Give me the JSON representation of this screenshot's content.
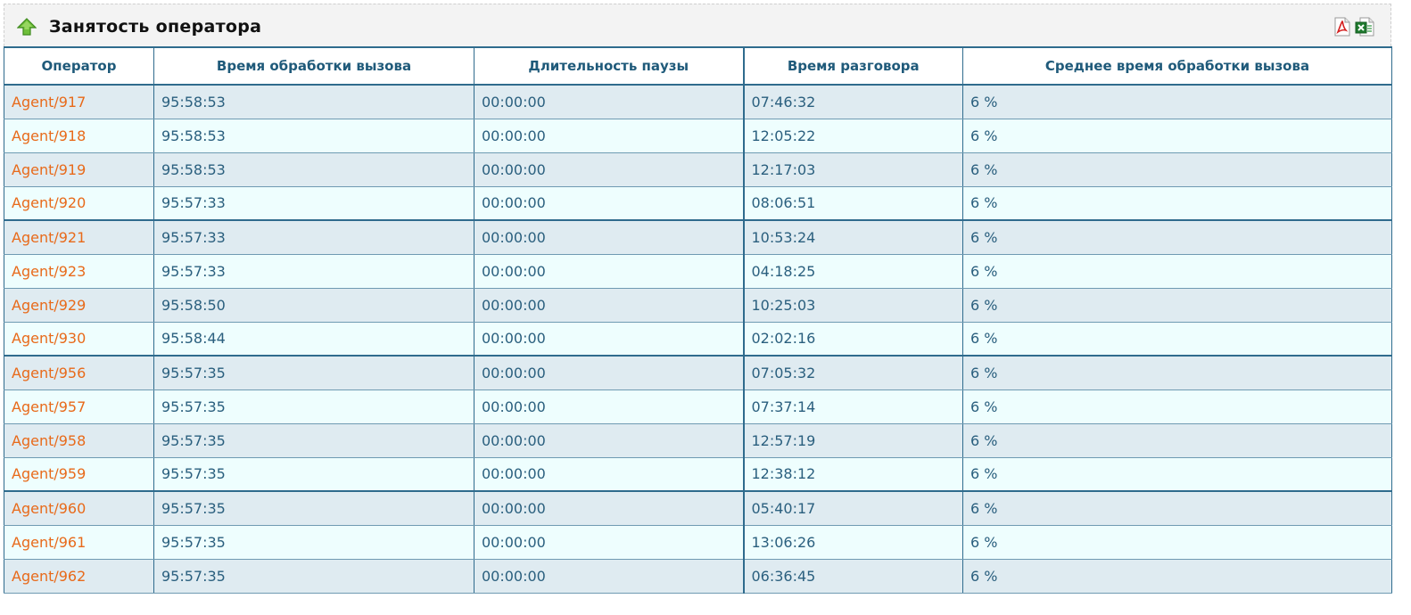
{
  "header": {
    "title": "Занятость оператора",
    "up_icon": "arrow-up-icon",
    "pdf_icon": "pdf-icon",
    "xls_icon": "excel-icon",
    "colors": {
      "agent": "#e86a1a",
      "text": "#2a5f7e",
      "border": "#2f6b8d"
    }
  },
  "table": {
    "columns": [
      "Оператор",
      "Время обработки вызова",
      "Длительность паузы",
      "Время разговора",
      "Среднее время обработки вызова"
    ],
    "rows": [
      [
        "Agent/917",
        "95:58:53",
        "00:00:00",
        "07:46:32",
        "6 %"
      ],
      [
        "Agent/918",
        "95:58:53",
        "00:00:00",
        "12:05:22",
        "6 %"
      ],
      [
        "Agent/919",
        "95:58:53",
        "00:00:00",
        "12:17:03",
        "6 %"
      ],
      [
        "Agent/920",
        "95:57:33",
        "00:00:00",
        "08:06:51",
        "6 %"
      ],
      [
        "Agent/921",
        "95:57:33",
        "00:00:00",
        "10:53:24",
        "6 %"
      ],
      [
        "Agent/923",
        "95:57:33",
        "00:00:00",
        "04:18:25",
        "6 %"
      ],
      [
        "Agent/929",
        "95:58:50",
        "00:00:00",
        "10:25:03",
        "6 %"
      ],
      [
        "Agent/930",
        "95:58:44",
        "00:00:00",
        "02:02:16",
        "6 %"
      ],
      [
        "Agent/956",
        "95:57:35",
        "00:00:00",
        "07:05:32",
        "6 %"
      ],
      [
        "Agent/957",
        "95:57:35",
        "00:00:00",
        "07:37:14",
        "6 %"
      ],
      [
        "Agent/958",
        "95:57:35",
        "00:00:00",
        "12:57:19",
        "6 %"
      ],
      [
        "Agent/959",
        "95:57:35",
        "00:00:00",
        "12:38:12",
        "6 %"
      ],
      [
        "Agent/960",
        "95:57:35",
        "00:00:00",
        "05:40:17",
        "6 %"
      ],
      [
        "Agent/961",
        "95:57:35",
        "00:00:00",
        "13:06:26",
        "6 %"
      ],
      [
        "Agent/962",
        "95:57:35",
        "00:00:00",
        "06:36:45",
        "6 %"
      ]
    ]
  }
}
